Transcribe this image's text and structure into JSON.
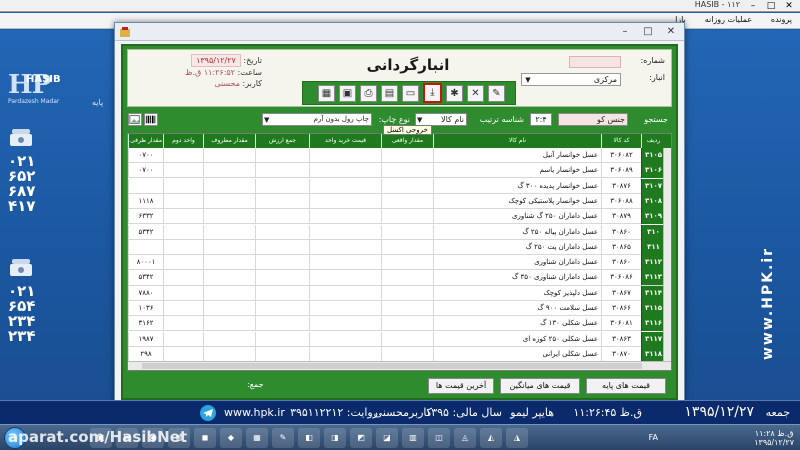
{
  "app": {
    "title": "HASIB - ۱۱۲",
    "menu": [
      "پرونده",
      "عملیات روزانه",
      "بازا"
    ]
  },
  "desktop": {
    "logo_big": "HP",
    "logo_word": "HASIB",
    "logo_sub": "Pardazesh Madar",
    "left_tag": "پایه",
    "phone_digits_1": [
      "۰۲۱",
      "۶۵۲",
      "۶۸۷",
      "۴۱۷"
    ],
    "phone_digits_2": [
      "۰۲۱",
      "۶۵۴",
      "۲۳۴",
      "۲۳۴"
    ],
    "vertical_url": "www.HPK.ir"
  },
  "dialog": {
    "title": "انبارگردانی",
    "date_label": "تاریخ:",
    "date_value": "۱۳۹۵/۱۲/۲۷",
    "time_label": "ساعت:",
    "time_value": "۱۱:۲۶:۵۲ ق.ظ",
    "user_label": "کاربر:",
    "user_value": "محسنی",
    "number_label": "شماره:",
    "store_label": "انبار:",
    "store_value": "مرکزی"
  },
  "toolbar": {
    "buttons": [
      {
        "name": "edit-icon",
        "glyph": "✎"
      },
      {
        "name": "delete-icon",
        "glyph": "✕"
      },
      {
        "name": "bug-icon",
        "glyph": "✱"
      },
      {
        "name": "excel-export-icon",
        "glyph": "⤓"
      },
      {
        "name": "new-doc-icon",
        "glyph": "▭"
      },
      {
        "name": "document-icon",
        "glyph": "▤"
      },
      {
        "name": "print-icon",
        "glyph": "⎙"
      },
      {
        "name": "save-icon",
        "glyph": "▣"
      },
      {
        "name": "list-icon",
        "glyph": "▦"
      },
      {
        "name": "minus-icon",
        "glyph": "▬"
      }
    ],
    "tooltip": "خروجی اکسل"
  },
  "filter": {
    "search_label": "جستجو",
    "search_value": "جنس کو",
    "sort_label": "شناسه ترتیب",
    "sort_value": "۲:۴",
    "sort_select": "نام کالا",
    "print_type_label": "نوع چاپ:",
    "print_type_value": "چاپ رول بدون آرم"
  },
  "grid": {
    "columns": [
      "ردیف",
      "کد کالا",
      "نام کالا",
      "مقدار واقعی",
      "قیمت خرید واحد",
      "جمع ارزش",
      "مقدار مظروف",
      "واحد دوم",
      "مقدار ظرفی"
    ],
    "rows": [
      {
        "row": "۳۱۰۵",
        "code": "۳۰۶۰۸۲",
        "name": "عسل خوانسار آنیل",
        "last": "۰۷۰۰"
      },
      {
        "row": "۳۱۰۶",
        "code": "۳۰۶۰۸۹",
        "name": "عسل خوانسار یاسم",
        "last": "۰۷۰۰"
      },
      {
        "row": "۳۱۰۷",
        "code": "۳۰۸۷۶",
        "name": "عسل خوانسار پدیده ۳۰۰ گ",
        "last": ""
      },
      {
        "row": "۳۱۰۸",
        "code": "۳۰۶۰۸۸",
        "name": "عسل خوانسار پلاستیکی کوچک",
        "last": "۱۱۱۸"
      },
      {
        "row": "۳۱۰۹",
        "code": "۳۰۸۷۹",
        "name": "عسل داماران ۲۵۰ گ شناوری",
        "last": "۶۳۳۲"
      },
      {
        "row": "۳۱۰",
        "code": "۳۰۸۶۰",
        "name": "عسل داماران پیاله ۲۵۰ گ",
        "last": "۵۳۴۲"
      },
      {
        "row": "۳۱۱",
        "code": "۳۰۸۶۵",
        "name": "عسل داماران پت ۲۵۰ گ",
        "last": ""
      },
      {
        "row": "۳۱۱۲",
        "code": "۳۰۸۶۰",
        "name": "عسل داماران شناوری",
        "last": "۸۰۰۰۱"
      },
      {
        "row": "۳۱۱۳",
        "code": "۳۰۶۰۸۶",
        "name": "عسل داماران شناوری ۳۵۰ گ",
        "last": "۵۳۴۲"
      },
      {
        "row": "۳۱۱۴",
        "code": "۳۰۸۶۷",
        "name": "عسل دلپذیر کوچک",
        "last": "۷۸۸۰"
      },
      {
        "row": "۳۱۱۵",
        "code": "۳۰۸۶۶",
        "name": "عسل سلامت ۹۰۰ گ",
        "last": "۱۰۳۶"
      },
      {
        "row": "۳۱۱۶",
        "code": "۳۰۶۰۸۱",
        "name": "عسل شکلی ۱۳۰ گ",
        "last": "۳۱۶۲"
      },
      {
        "row": "۳۱۱۷",
        "code": "۳۰۸۶۳",
        "name": "عسل شکلی ۲۵۰ کوزه ای",
        "last": "۱۹۸۷"
      },
      {
        "row": "۳۱۱۸",
        "code": "۳۰۸۷۰",
        "name": "عسل شکلی ایرانی",
        "last": "۲۹۸"
      }
    ]
  },
  "footer": {
    "btn_base_prices": "قیمت های پایه",
    "btn_avg_prices": "قیمت های میانگین",
    "btn_last_prices": "آخرین قیمت ها",
    "total_label": "جمع:"
  },
  "banner": {
    "weekday": "جمعه",
    "date": "۱۳۹۵/۱۲/۲۷",
    "time": "۱۱:۲۶:۴۵ ق.ظ",
    "store": "هایپر لیمو",
    "fiscal_year": "سال مالی: ۱۳۹۵",
    "user": "کاربرمحسنی",
    "version": "روایت: ۳۹۵۱۱۲۲۱۲",
    "url": "www.hpk.ir"
  },
  "taskbar": {
    "watermark": "aparat.com/HasibNet",
    "lang": "FA",
    "clock_time": "۱۱:۲۸ ق.ظ",
    "clock_date": "۱۳۹۵/۱۲/۲۷"
  }
}
